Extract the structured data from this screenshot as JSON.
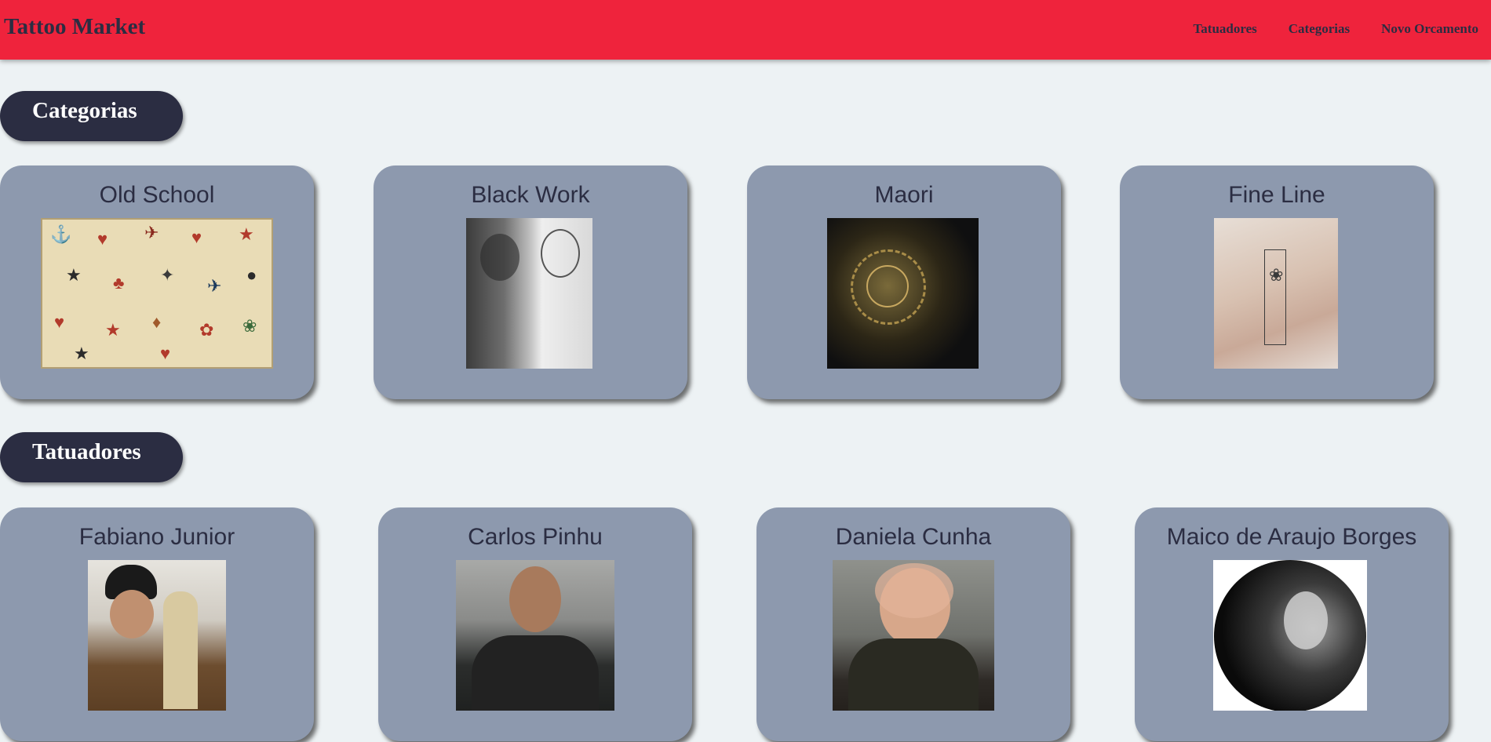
{
  "navbar": {
    "brand": "Tattoo Market",
    "links": [
      "Tatuadores",
      "Categorias",
      "Novo Orcamento"
    ]
  },
  "sections": {
    "categorias": {
      "title": "Categorias",
      "cards": [
        {
          "title": "Old School",
          "image": "old-school-flash-image"
        },
        {
          "title": "Black Work",
          "image": "black-work-arm-image"
        },
        {
          "title": "Maori",
          "image": "maori-shoulder-image"
        },
        {
          "title": "Fine Line",
          "image": "fine-line-forearm-image"
        }
      ]
    },
    "tatuadores": {
      "title": "Tatuadores",
      "cards": [
        {
          "title": "Fabiano Junior",
          "image": "fabiano-junior-photo"
        },
        {
          "title": "Carlos Pinhu",
          "image": "carlos-pinhu-photo"
        },
        {
          "title": "Daniela Cunha",
          "image": "daniela-cunha-photo"
        },
        {
          "title": "Maico de Araujo Borges",
          "image": "maico-borges-photo"
        }
      ]
    }
  },
  "colors": {
    "navbar": "#ef233c",
    "background": "#edf2f4",
    "card": "#8d99ae",
    "dark": "#2b2d42"
  }
}
